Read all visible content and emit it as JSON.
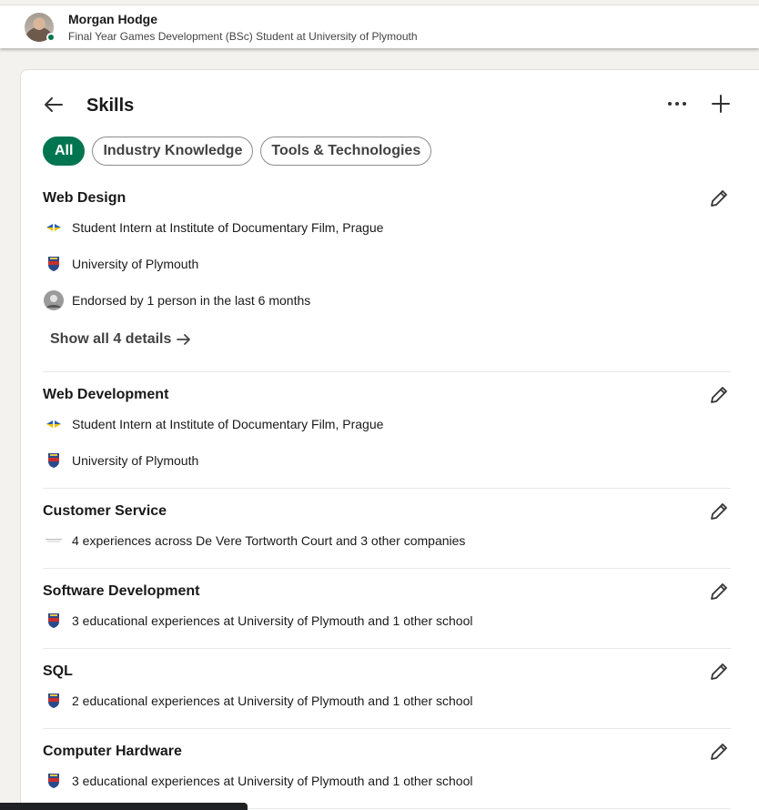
{
  "profile": {
    "name": "Morgan Hodge",
    "headline": "Final Year Games Development (BSc) Student at University of Plymouth"
  },
  "header": {
    "title": "Skills"
  },
  "filters": [
    {
      "label": "All",
      "active": true
    },
    {
      "label": "Industry Knowledge",
      "active": false
    },
    {
      "label": "Tools & Technologies",
      "active": false
    }
  ],
  "skills": [
    {
      "name": "Web Design",
      "details": [
        {
          "icon": "ukraine-flag-logo",
          "text": "Student Intern at Institute of Documentary Film, Prague"
        },
        {
          "icon": "university-crest-logo",
          "text": "University of Plymouth"
        },
        {
          "icon": "endorser-avatar",
          "text": "Endorsed by 1 person in the last 6 months"
        }
      ],
      "show_all": "Show all 4 details"
    },
    {
      "name": "Web Development",
      "details": [
        {
          "icon": "ukraine-flag-logo",
          "text": "Student Intern at Institute of Documentary Film, Prague"
        },
        {
          "icon": "university-crest-logo",
          "text": "University of Plymouth"
        }
      ]
    },
    {
      "name": "Customer Service",
      "details": [
        {
          "icon": "company-logo",
          "text": "4 experiences across De Vere Tortworth Court and 3 other companies"
        }
      ]
    },
    {
      "name": "Software Development",
      "details": [
        {
          "icon": "university-crest-logo",
          "text": "3 educational experiences at University of Plymouth and 1 other school"
        }
      ]
    },
    {
      "name": "SQL",
      "details": [
        {
          "icon": "university-crest-logo",
          "text": "2 educational experiences at University of Plymouth and 1 other school"
        }
      ]
    },
    {
      "name": "Computer Hardware",
      "details": [
        {
          "icon": "university-crest-logo",
          "text": "3 educational experiences at University of Plymouth and 1 other school"
        }
      ]
    }
  ],
  "colors": {
    "accent": "#01754f",
    "card": "#ffffff",
    "background": "#f4f2ee"
  }
}
